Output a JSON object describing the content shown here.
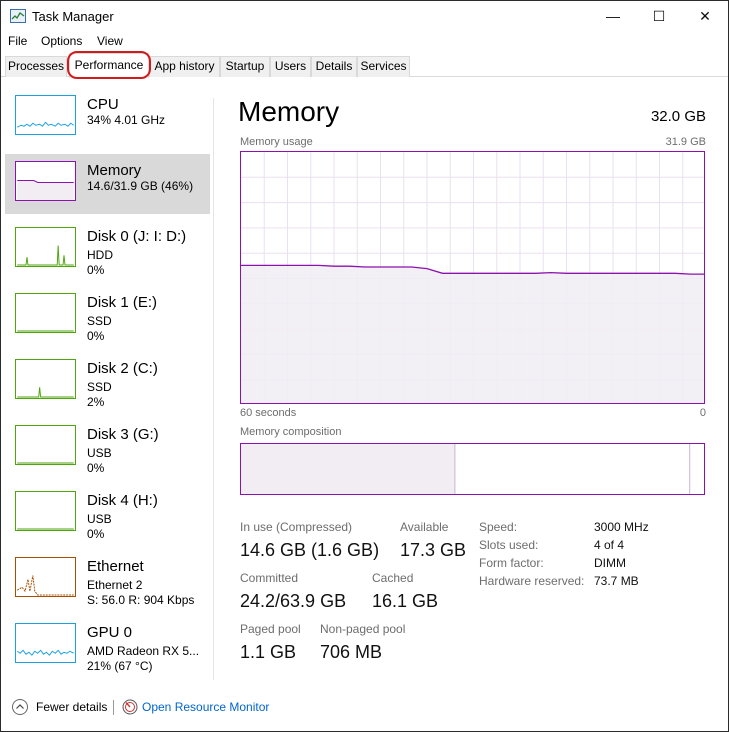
{
  "window": {
    "title": "Task Manager",
    "buttons": {
      "minimize": "—",
      "maximize": "☐",
      "close": "✕"
    }
  },
  "menu": [
    "File",
    "Options",
    "View"
  ],
  "tabs": [
    "Processes",
    "Performance",
    "App history",
    "Startup",
    "Users",
    "Details",
    "Services"
  ],
  "active_tab": "Performance",
  "sidebar": {
    "items": [
      {
        "name": "CPU",
        "line2": "34%  4.01 GHz",
        "line3": "",
        "color": "#1ba1e2"
      },
      {
        "name": "Memory",
        "line2": "14.6/31.9 GB (46%)",
        "line3": "",
        "color": "#8b12ae"
      },
      {
        "name": "Disk 0 (J: I: D:)",
        "line2": "HDD",
        "line3": "0%",
        "color": "#4da60c"
      },
      {
        "name": "Disk 1 (E:)",
        "line2": "SSD",
        "line3": "0%",
        "color": "#4da60c"
      },
      {
        "name": "Disk 2 (C:)",
        "line2": "SSD",
        "line3": "2%",
        "color": "#4da60c"
      },
      {
        "name": "Disk 3 (G:)",
        "line2": "USB",
        "line3": "0%",
        "color": "#4da60c"
      },
      {
        "name": "Disk 4 (H:)",
        "line2": "USB",
        "line3": "0%",
        "color": "#4da60c"
      },
      {
        "name": "Ethernet",
        "line2": "Ethernet 2",
        "line3": "S: 56.0  R: 904 Kbps",
        "color": "#a74f01"
      },
      {
        "name": "GPU 0",
        "line2": "AMD Radeon RX 5...",
        "line3": "21% (67 °C)",
        "color": "#1ba1e2"
      }
    ]
  },
  "main": {
    "title": "Memory",
    "total": "32.0 GB",
    "usage_label": "Memory usage",
    "usage_max": "31.9 GB",
    "axis_left": "60 seconds",
    "axis_right": "0",
    "composition_label": "Memory composition",
    "stats": {
      "in_use_label": "In use (Compressed)",
      "in_use_value": "14.6 GB (1.6 GB)",
      "available_label": "Available",
      "available_value": "17.3 GB",
      "committed_label": "Committed",
      "committed_value": "24.2/63.9 GB",
      "cached_label": "Cached",
      "cached_value": "16.1 GB",
      "paged_label": "Paged pool",
      "paged_value": "1.1 GB",
      "nonpaged_label": "Non-paged pool",
      "nonpaged_value": "706 MB"
    },
    "details": [
      {
        "label": "Speed:",
        "value": "3000 MHz"
      },
      {
        "label": "Slots used:",
        "value": "4 of 4"
      },
      {
        "label": "Form factor:",
        "value": "DIMM"
      },
      {
        "label": "Hardware reserved:",
        "value": "73.7 MB"
      }
    ],
    "usage_series_gb": [
      17.6,
      17.6,
      17.6,
      17.6,
      17.6,
      17.6,
      17.5,
      17.5,
      17.4,
      17.4,
      17.4,
      17.4,
      17.2,
      16.6,
      16.6,
      16.6,
      16.6,
      16.6,
      16.6,
      16.6,
      16.7,
      16.6,
      16.6,
      16.6,
      16.6,
      16.6,
      16.6,
      16.6,
      16.6,
      16.5,
      16.5
    ],
    "usage_scale_max_gb": 31.9,
    "composition": {
      "in_use_fraction": 0.46,
      "standby_end_fraction": 0.965
    }
  },
  "footer": {
    "fewer_details": "Fewer details",
    "open_resource_monitor": "Open Resource Monitor"
  },
  "colors": {
    "memory": "#8b12ae",
    "memory_fill": "#f1edf3",
    "cpu": "#1ba1e2",
    "disk": "#4da60c",
    "ethernet": "#a74f01",
    "link": "#0066cc",
    "highlight": "#d21c1c"
  },
  "icons": [
    "task-manager-icon",
    "chevron-up-icon",
    "resource-monitor-icon"
  ]
}
